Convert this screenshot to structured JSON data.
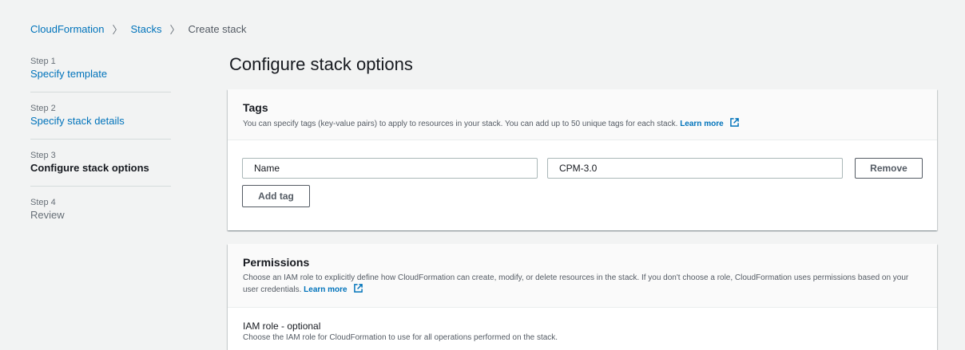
{
  "breadcrumb": {
    "items": [
      "CloudFormation",
      "Stacks"
    ],
    "current": "Create stack",
    "separator": "〉"
  },
  "steps": [
    {
      "step": "Step 1",
      "label": "Specify template",
      "state": "link"
    },
    {
      "step": "Step 2",
      "label": "Specify stack details",
      "state": "link"
    },
    {
      "step": "Step 3",
      "label": "Configure stack options",
      "state": "active"
    },
    {
      "step": "Step 4",
      "label": "Review",
      "state": "disabled"
    }
  ],
  "page_title": "Configure stack options",
  "tags": {
    "title": "Tags",
    "description": "You can specify tags (key-value pairs) to apply to resources in your stack. You can add up to 50 unique tags for each stack.",
    "learn_more": "Learn more",
    "key_value": "Name",
    "value_value": "CPM-3.0",
    "remove_label": "Remove",
    "add_tag_label": "Add tag"
  },
  "permissions": {
    "title": "Permissions",
    "description": "Choose an IAM role to explicitly define how CloudFormation can create, modify, or delete resources in the stack. If you don't choose a role, CloudFormation uses permissions based on your user credentials.",
    "learn_more": "Learn more",
    "iam_label": "IAM role - optional",
    "iam_desc": "Choose the IAM role for CloudFormation to use for all operations performed on the stack."
  },
  "colors": {
    "link": "#0073bb",
    "text": "#16191f",
    "muted": "#687078",
    "background": "#f2f3f3"
  },
  "icons": [
    "external-link-icon"
  ]
}
